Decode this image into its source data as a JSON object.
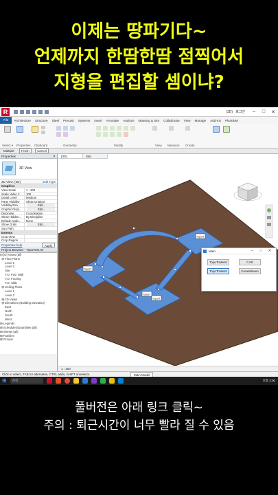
{
  "headline": {
    "line1": "이제는 땅파기다~",
    "line2": "언제까지 한땀한땀 점찍어서",
    "line3": "지형을 편집할 셈이냐?"
  },
  "footer": {
    "line1": "풀버전은 아래 링크 클릭~",
    "line2": "주의 : 퇴근시간이 너무 빨라 질 수 있음"
  },
  "app": {
    "logo": "R",
    "title": "(3D)",
    "user": "로그인",
    "controls": [
      "–",
      "□",
      "✕"
    ],
    "colors": {
      "accent": "#1f5fa8",
      "brand": "#c8102e",
      "terrain": "#6b4a37",
      "pad": "#5b8fd6"
    }
  },
  "ribbon": {
    "tabs": [
      "File",
      "Architecture",
      "Structure",
      "Steel",
      "Precast",
      "Systems",
      "Insert",
      "Annotate",
      "Analyze",
      "Massing & Site",
      "Collaborate",
      "View",
      "Manage",
      "Add-Ins",
      "PlantBIM"
    ],
    "buttons": [
      "Select ▾",
      "Properties",
      "Clipboard",
      "Geometry",
      "Modify",
      "View",
      "Measure",
      "Create"
    ],
    "groups": [
      "Select ▾",
      "Properties",
      "Clipboard",
      "Geometry",
      "Modify",
      "View",
      "Measure",
      "Create"
    ]
  },
  "options_bar": {
    "items": [
      "Multiple",
      "Finish",
      "Cancel"
    ]
  },
  "properties": {
    "header": "Properties",
    "close": "✕",
    "type_name": "3D View",
    "filter": "3D View: {3D}",
    "edit_type": "Edit Type",
    "categories": [
      "Graphics",
      "Extents"
    ],
    "rows_graphics": [
      [
        "View Scale",
        "1 : 100"
      ],
      [
        "Scale Value 1:",
        "100"
      ],
      [
        "Detail Level",
        "Medium"
      ],
      [
        "Parts Visibility",
        "Show Original"
      ],
      [
        "Visibility/Gra...",
        "Edit..."
      ],
      [
        "Graphic Displ...",
        "Edit..."
      ],
      [
        "Discipline",
        "Coordination"
      ],
      [
        "Show Hidden...",
        "By Discipline"
      ],
      [
        "Default Analy...",
        "None"
      ],
      [
        "Show Grids",
        "Edit..."
      ],
      [
        "Sun Path",
        ""
      ]
    ],
    "rows_extents": [
      [
        "Crop View",
        ""
      ],
      [
        "Crop Region ...",
        ""
      ]
    ],
    "help_link": "Properties help",
    "apply": "Apply"
  },
  "browser": {
    "header": "Project Browser - TopoTest.rvt",
    "items": [
      "⊟ [O] Views (all)",
      "  ⊟ Floor Plans",
      "      Level 1",
      "      Level 2",
      "      Site",
      "      T.O. Fnd. Wall",
      "      T.O. Footing",
      "      T.O. Slab",
      "  ⊟ Ceiling Plans",
      "      Level 1",
      "      Level 2",
      "  ⊞ 3D Views",
      "  ⊟ Elevations (Building Elevation)",
      "      East",
      "      North",
      "      South",
      "      West",
      "⊞ Legends",
      "⊞ Schedules/Quantities (all)",
      "⊞ Sheets (all)",
      "⊞ Families",
      "⊞ Groups"
    ]
  },
  "viewport": {
    "tabs": [
      "{3D}",
      "Site"
    ],
    "viewbar": "1 : 100",
    "pad_labels": [
      "ToposT",
      "ToposT",
      "ToposT",
      "ToposT"
    ]
  },
  "dialog": {
    "title": "Main",
    "controls": "– □ ✕",
    "buttons": [
      "TopoToMesh",
      "CAD",
      "TopoToMesh",
      "CreateBeam"
    ]
  },
  "status": {
    "text": "Click to select, TAB for alternates, CTRL adds, SHIFT unselects.",
    "model": "Main Model"
  },
  "taskbar": {
    "search": "검색",
    "time": "오후 3:00"
  }
}
